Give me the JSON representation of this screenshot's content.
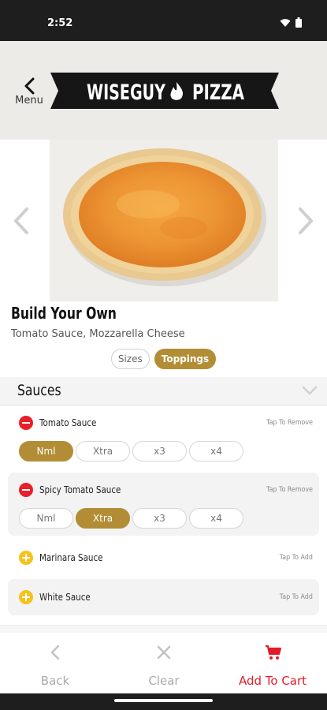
{
  "status_bar": {
    "time": "2:52",
    "icons": [
      "wifi-icon",
      "battery-icon"
    ]
  },
  "header": {
    "back_label": "Menu",
    "logo_text_left": "WISEGUY",
    "logo_text_right": "PIZZA",
    "logo_icon": "flame-icon"
  },
  "carousel": {
    "prev_icon": "chevron-left-icon",
    "next_icon": "chevron-right-icon"
  },
  "item": {
    "title": "Build Your Own",
    "description": "Tomato Sauce, Mozzarella Cheese"
  },
  "tabs": [
    {
      "label": "Sizes",
      "active": false
    },
    {
      "label": "Toppings",
      "active": true
    }
  ],
  "section": {
    "title": "Sauces"
  },
  "sauces": [
    {
      "name": "Tomato Sauce",
      "action": "Tap To Remove",
      "selected": true,
      "options": [
        "Nml",
        "Xtra",
        "x3",
        "x4"
      ],
      "selected_option": "Nml"
    },
    {
      "name": "Spicy Tomato Sauce",
      "action": "Tap To Remove",
      "selected": true,
      "options": [
        "Nml",
        "Xtra",
        "x3",
        "x4"
      ],
      "selected_option": "Xtra"
    },
    {
      "name": "Marinara Sauce",
      "action": "Tap To Add",
      "selected": false
    },
    {
      "name": "White Sauce",
      "action": "Tap To Add",
      "selected": false
    }
  ],
  "bottom_bar": {
    "back": "Back",
    "clear": "Clear",
    "add_to_cart": "Add To Cart"
  },
  "colors": {
    "accent_gold": "#b38d35",
    "remove_red": "#e8202a",
    "add_yellow": "#f7c21b",
    "cart_red": "#e31c2a"
  }
}
